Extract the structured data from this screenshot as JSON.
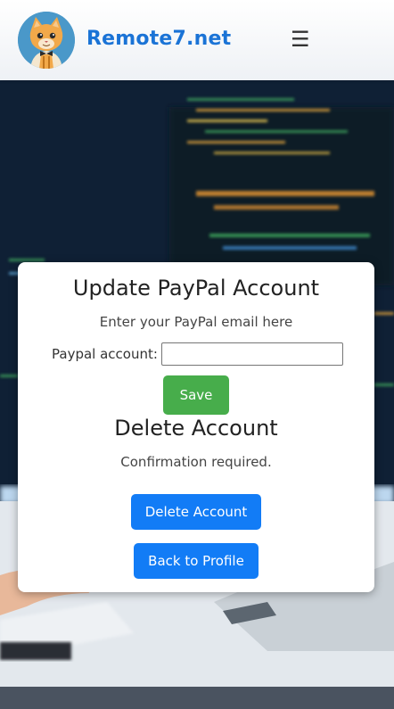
{
  "header": {
    "brand": "Remote7.net",
    "menu_icon": "☰",
    "logo_icon": "cat-mascot-logo"
  },
  "paypal_section": {
    "title": "Update PayPal Account",
    "instructions": "Enter your PayPal email here",
    "field_label": "Paypal account:",
    "field_value": "",
    "field_placeholder": "",
    "save_label": "Save"
  },
  "delete_section": {
    "title": "Delete Account",
    "confirmation_text": "Confirmation required.",
    "delete_label": "Delete Account"
  },
  "back_label": "Back to Profile",
  "colors": {
    "brand": "#1a73d6",
    "save_button": "#47ad4b",
    "primary_button": "#127cf6",
    "header_bg": "#ffffff"
  }
}
